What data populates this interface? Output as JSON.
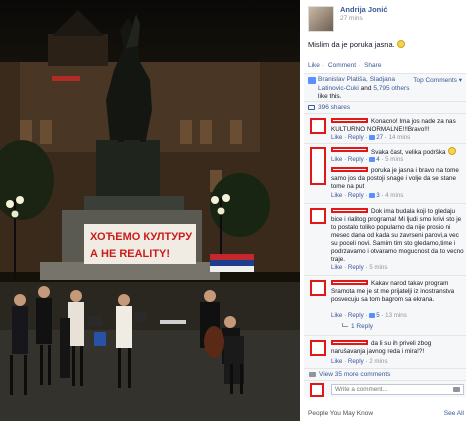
{
  "post": {
    "author": "Andrija Jonić",
    "time": "27 mins",
    "text": "Mislim da je poruka jasna."
  },
  "actions": {
    "like": "Like",
    "comment": "Comment",
    "share": "Share"
  },
  "likes": {
    "names": "Branislav Platiša, Sladjana Latinovic-Cuki",
    "and": "and",
    "others": "5,795 others",
    "suffix": "like this.",
    "top_comments": "Top Comments"
  },
  "shares": "396 shares",
  "banner": {
    "line1": "ХОЋЕМО КУЛТУРУ",
    "line2": "А НЕ REALITY!"
  },
  "comments": [
    {
      "text": "Konacno! Ima jos nade za nas KULTURNO NORMALNE!!!Bravo!!!",
      "like": "Like",
      "reply": "Reply",
      "likes": "27",
      "time": "14 mins"
    },
    {
      "text": "Svaka čast, velika podrška",
      "like": "Like",
      "reply": "Reply",
      "likes": "4",
      "time": "5 mins"
    },
    {
      "text": "poruka je jasna i bravo na tome samo jos da postoji snage i volje da se stane tome na put",
      "like": "Like",
      "reply": "Reply",
      "likes": "3",
      "time": "4 mins"
    },
    {
      "text": "Dok ima budala koji to gledaju bice i rialitog programa! Mi ljudi smo krivi sto je to postalo toliko popularno da nije prosio ni mesec dana od kada su zavrseni parovi,a vec su poceli novi. Samim tim sto gledamo,time i podrzavamo i otvaramo mogucnost da to vecno traje.",
      "like": "Like",
      "reply": "Reply",
      "likes": "",
      "time": "5 mins"
    },
    {
      "text": "Kakav narod takav program Sramota me je st me prijatelji iz inostranstva posvecuju sa tom bagrom sa ekrana.",
      "like": "Like",
      "reply": "Reply",
      "likes": "5",
      "time": "13 mins"
    },
    {
      "text": "da li su ih priveli zbog narušavanja javnog reda i mira!?!",
      "like": "Like",
      "reply": "Reply",
      "likes": "",
      "time": "2 mins"
    }
  ],
  "reply_link": "1 Reply",
  "more_comments": "View 35 more comments",
  "write_placeholder": "Write a comment...",
  "footer": {
    "people": "People You May Know",
    "see_all": "See All"
  },
  "colors": {
    "link": "#3b5998",
    "redaction": "#e01818",
    "panel_bg": "#f6f7f9"
  }
}
